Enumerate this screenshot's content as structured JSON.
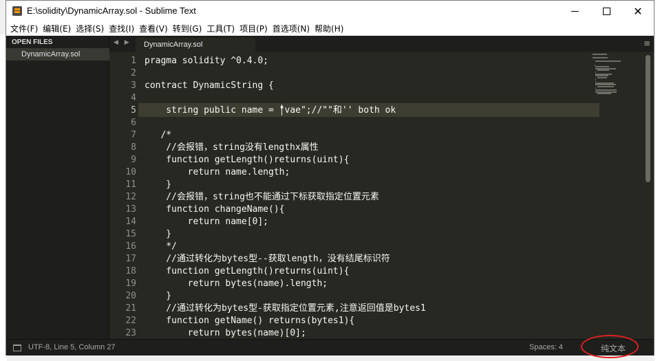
{
  "window": {
    "title": "E:\\solidity\\DynamicArray.sol - Sublime Text"
  },
  "menu": [
    "文件(F)",
    "编辑(E)",
    "选择(S)",
    "查找(I)",
    "查看(V)",
    "转到(G)",
    "工具(T)",
    "项目(P)",
    "首选项(N)",
    "帮助(H)"
  ],
  "sidebar": {
    "header": "OPEN FILES",
    "files": [
      "DynamicArray.sol"
    ]
  },
  "tabs": {
    "nav": "◀ ▶",
    "active": "DynamicArray.sol",
    "menu_glyph": "≡"
  },
  "editor": {
    "current_line": 5,
    "lines": [
      {
        "n": "1",
        "text": "pragma solidity ^0.4.0;"
      },
      {
        "n": "2",
        "text": ""
      },
      {
        "n": "3",
        "text": "contract DynamicString {"
      },
      {
        "n": "4",
        "text": ""
      },
      {
        "n": "5",
        "text": "    string public name = \"vae\";//\"\"和'' both ok"
      },
      {
        "n": "6",
        "text": ""
      },
      {
        "n": "7",
        "text": "   /*"
      },
      {
        "n": "8",
        "text": "    //会报错，string没有lengthx属性"
      },
      {
        "n": "9",
        "text": "    function getLength()returns(uint){"
      },
      {
        "n": "10",
        "text": "        return name.length;"
      },
      {
        "n": "11",
        "text": "    }"
      },
      {
        "n": "12",
        "text": "    //会报错，string也不能通过下标获取指定位置元素"
      },
      {
        "n": "13",
        "text": "    function changeName(){"
      },
      {
        "n": "14",
        "text": "        return name[0];"
      },
      {
        "n": "15",
        "text": "    }"
      },
      {
        "n": "16",
        "text": "    */"
      },
      {
        "n": "17",
        "text": "    //通过转化为bytes型--获取length，没有结尾标识符"
      },
      {
        "n": "18",
        "text": "    function getLength()returns(uint){"
      },
      {
        "n": "19",
        "text": "        return bytes(name).length;"
      },
      {
        "n": "20",
        "text": "    }"
      },
      {
        "n": "21",
        "text": "    //通过转化为bytes型-获取指定位置元素,注意返回值是bytes1"
      },
      {
        "n": "22",
        "text": "    function getName() returns(bytes1){"
      },
      {
        "n": "23",
        "text": "        return bytes(name)[0];"
      }
    ]
  },
  "status": {
    "left": "UTF-8, Line 5, Column 27",
    "spaces": "Spaces: 4",
    "syntax": "纯文本"
  },
  "colors": {
    "editor_bg": "#272822",
    "sidebar_bg": "#1e1f1c",
    "highlight": "#e02020"
  }
}
